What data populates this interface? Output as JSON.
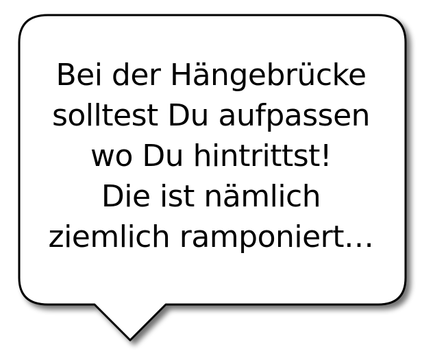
{
  "dialog": {
    "lines": [
      "Bei der Hängebrücke",
      "solltest Du aufpassen",
      "wo Du hintrittst!",
      "Die ist nämlich",
      "ziemlich ramponiert…"
    ]
  },
  "colors": {
    "bubble_fill": "#ffffff",
    "bubble_stroke": "#000000",
    "shadow": "#555555",
    "text": "#000000"
  }
}
